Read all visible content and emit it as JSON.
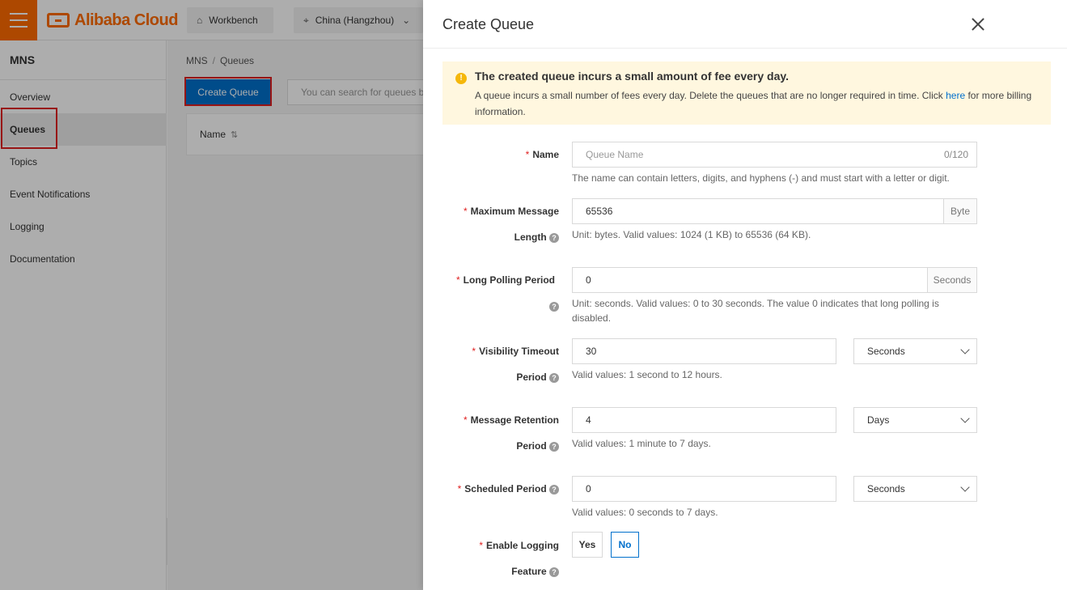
{
  "topbar": {
    "brand": "Alibaba Cloud",
    "workbench": "Workbench",
    "region": "China (Hangzhou)"
  },
  "sidebar": {
    "title": "MNS",
    "items": [
      {
        "label": "Overview"
      },
      {
        "label": "Queues"
      },
      {
        "label": "Topics"
      },
      {
        "label": "Event Notifications"
      },
      {
        "label": "Logging"
      },
      {
        "label": "Documentation"
      }
    ]
  },
  "main": {
    "breadcrumb": [
      "MNS",
      "Queues"
    ],
    "breadcrumb_sep": "/",
    "create_button": "Create Queue",
    "search_placeholder": "You can search for queues b",
    "table_columns": [
      "Name"
    ]
  },
  "drawer": {
    "title": "Create Queue",
    "notice": {
      "title": "The created queue incurs a small amount of fee every day.",
      "text_before": "A queue incurs a small number of fees every day. Delete the queues that are no longer required in time. Click ",
      "link": "here",
      "text_after": " for more billing information."
    },
    "required_mark": "*",
    "fields": {
      "name": {
        "label": "Name",
        "placeholder": "Queue Name",
        "counter": "0/120",
        "hint": "The name can contain letters, digits, and hyphens (-) and must start with a letter or digit."
      },
      "max_message_length": {
        "label_line1": "Maximum Message",
        "label_line2": "Length",
        "value": "65536",
        "unit": "Byte",
        "hint": "Unit: bytes. Valid values: 1024 (1 KB) to 65536 (64 KB)."
      },
      "long_polling": {
        "label": "Long Polling Period",
        "value": "0",
        "unit": "Seconds",
        "hint": "Unit: seconds. Valid values: 0 to 30 seconds. The value 0 indicates that long polling is disabled."
      },
      "visibility_timeout": {
        "label_line1": "Visibility Timeout",
        "label_line2": "Period",
        "value": "30",
        "unit": "Seconds",
        "hint": "Valid values: 1 second to 12 hours."
      },
      "message_retention": {
        "label_line1": "Message Retention",
        "label_line2": "Period",
        "value": "4",
        "unit": "Days",
        "hint": "Valid values: 1 minute to 7 days."
      },
      "scheduled_period": {
        "label": "Scheduled Period",
        "value": "0",
        "unit": "Seconds",
        "hint": "Valid values: 0 seconds to 7 days."
      },
      "enable_logging": {
        "label_line1": "Enable Logging",
        "label_line2": "Feature",
        "options": [
          "Yes",
          "No"
        ],
        "selected": "No"
      }
    }
  },
  "icons": {
    "help": "?",
    "warning": "!",
    "sort": "⇅",
    "collapse": "‹"
  }
}
